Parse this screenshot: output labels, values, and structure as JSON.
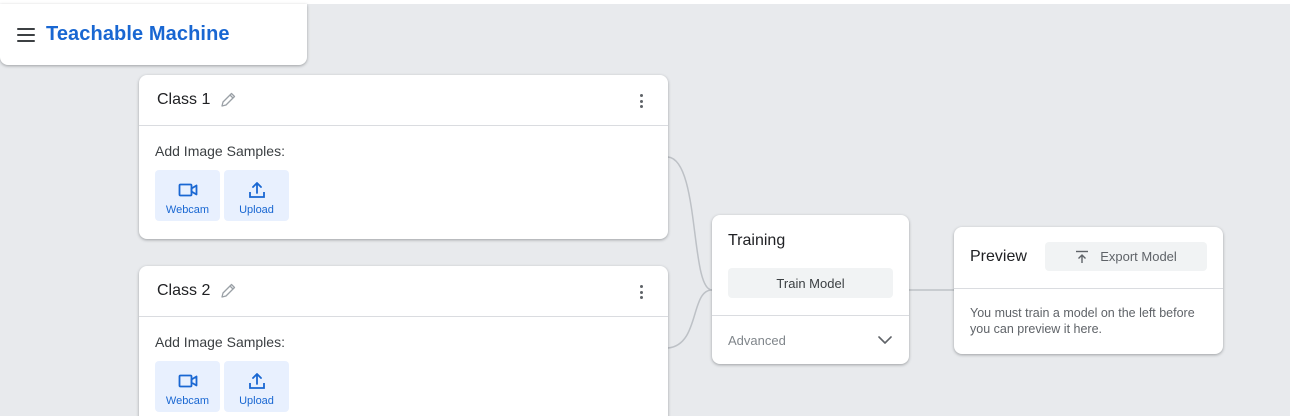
{
  "app": {
    "title": "Teachable Machine",
    "accent_color": "#1967d2",
    "menu_icon": "hamburger-menu-icon"
  },
  "classes": [
    {
      "name": "Class 1",
      "samples_label": "Add Image Samples:",
      "buttons": [
        {
          "label": "Webcam",
          "icon": "webcam-icon"
        },
        {
          "label": "Upload",
          "icon": "upload-icon"
        }
      ]
    },
    {
      "name": "Class 2",
      "samples_label": "Add Image Samples:",
      "buttons": [
        {
          "label": "Webcam",
          "icon": "webcam-icon"
        },
        {
          "label": "Upload",
          "icon": "upload-icon"
        }
      ]
    }
  ],
  "training": {
    "title": "Training",
    "train_button": "Train Model",
    "advanced_label": "Advanced"
  },
  "preview": {
    "title": "Preview",
    "export_button": "Export Model",
    "message": "You must train a model on the left before you can preview it here."
  }
}
